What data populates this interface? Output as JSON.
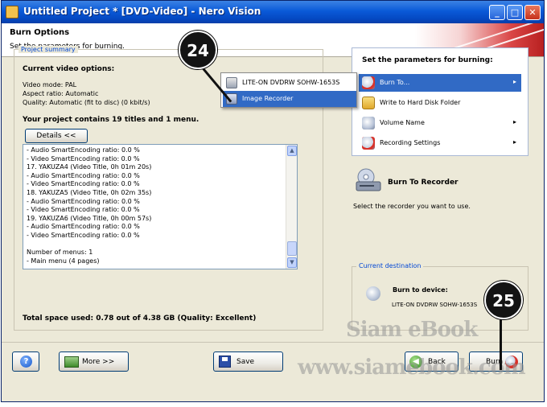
{
  "window": {
    "title": "Untitled Project * [DVD-Video] - Nero Vision",
    "minimize": "_",
    "maximize": "□",
    "close": "✕"
  },
  "header": {
    "title": "Burn Options",
    "subtitle": "Set the parameters for burning."
  },
  "summary": {
    "legend": "Project summary",
    "current_title": "Current video options:",
    "video_mode": "Video mode: PAL",
    "aspect_ratio": "Aspect ratio: Automatic",
    "quality": "Quality: Automatic (fit to disc) (0 kbit/s)",
    "contains": "Your project contains 19 titles and 1 menu.",
    "details_button": "Details <<",
    "log_lines": [
      "- Audio SmartEncoding ratio: 0.0 %",
      "- Video SmartEncoding ratio: 0.0 %",
      "17. YAKUZA4 (Video Title, 0h 01m 20s)",
      "- Audio SmartEncoding ratio: 0.0 %",
      "- Video SmartEncoding ratio: 0.0 %",
      "18. YAKUZA5 (Video Title, 0h 02m 35s)",
      "- Audio SmartEncoding ratio: 0.0 %",
      "- Video SmartEncoding ratio: 0.0 %",
      "19. YAKUZA6 (Video Title, 0h 00m 57s)",
      "- Audio SmartEncoding ratio: 0.0 %",
      "- Video SmartEncoding ratio: 0.0 %",
      "",
      "Number of menus: 1",
      "- Main menu (4 pages)"
    ],
    "total_space": "Total space used: 0.78 out of 4.38 GB (Quality: Excellent)"
  },
  "burn_panel": {
    "title": "Set the parameters for burning:",
    "items": [
      {
        "label": "Burn To...",
        "has_submenu": true,
        "selected": true
      },
      {
        "label": "Write to Hard Disk Folder",
        "has_submenu": false,
        "selected": false
      },
      {
        "label": "Volume Name",
        "has_submenu": true,
        "selected": false
      },
      {
        "label": "Recording Settings",
        "has_submenu": true,
        "selected": false
      }
    ],
    "submenu_arrow": "▸"
  },
  "popup_menu": {
    "items": [
      {
        "label": "LITE-ON  DVDRW SOHW-1653S",
        "selected": false
      },
      {
        "label": "Image Recorder",
        "selected": true
      }
    ]
  },
  "recorder": {
    "title": "Burn To Recorder",
    "description": "Select the recorder you want to use."
  },
  "destination": {
    "legend": "Current destination",
    "title": "Burn to device:",
    "device": "LITE-ON  DVDRW SOHW-1653S"
  },
  "footer": {
    "help_button": "?",
    "more_button": "More >>",
    "save_button": "Save",
    "back_button": "Back",
    "burn_button": "Burn"
  },
  "callouts": {
    "first": "24",
    "second": "25"
  },
  "watermark": {
    "line1": "Siam eBook",
    "line2": "www.siamebook.com"
  },
  "colors": {
    "title_bar": "#0a5ad8",
    "selection": "#316ac5",
    "legend_text": "#0046d5",
    "window_bg": "#ece9d8"
  }
}
